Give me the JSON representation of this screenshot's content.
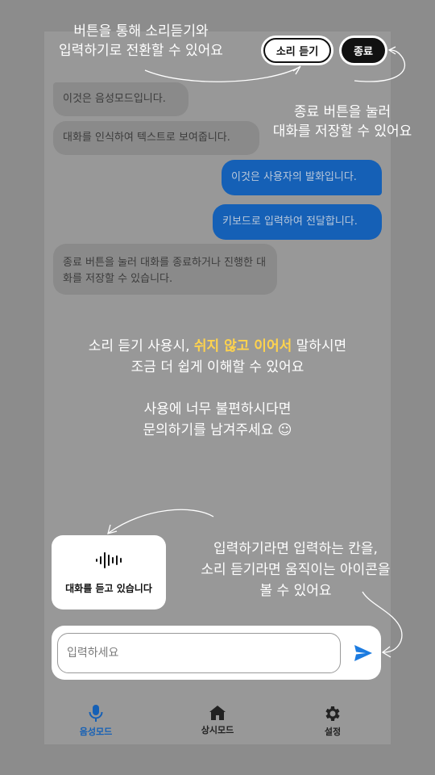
{
  "top_buttons": {
    "listen_label": "소리 듣기",
    "end_label": "종료"
  },
  "messages": [
    {
      "role": "bot",
      "text": "이것은 음성모드입니다."
    },
    {
      "role": "bot",
      "text": "대화를 인식하여 텍스트로 보여줍니다."
    },
    {
      "role": "user",
      "text": "이것은 사용자의 발화입니다."
    },
    {
      "role": "user",
      "text": "키보드로 입력하여 전달합니다."
    },
    {
      "role": "bot",
      "text": "종료 버튼을 눌러 대화를 종료하거나 진행한 대화를 저장할 수 있습니다."
    }
  ],
  "tutorial": {
    "top_line1": "버튼을 통해 소리듣기와",
    "top_line2": "입력하기로 전환할 수 있어요",
    "end_line1": "종료 버튼을 눌러",
    "end_line2": "대화를 저장할 수 있어요",
    "mid_line1_pre": "소리 듣기 사용시, ",
    "mid_line1_highlight": "쉬지 않고 이어서",
    "mid_line1_post": " 말하시면",
    "mid_line2": "조금 더 쉽게 이해할 수 있어요",
    "mid_line3": "사용에 너무 불편하시다면",
    "mid_line4": "문의하기를 남겨주세요 ☺",
    "bottom_line1": "입력하기라면 입력하는 칸을,",
    "bottom_line2": "소리 듣기라면 움직이는 아이콘을",
    "bottom_line3": "볼 수 있어요"
  },
  "listen_card": {
    "label": "대화를 듣고 있습니다"
  },
  "input": {
    "placeholder": "입력하세요",
    "value": ""
  },
  "nav": [
    {
      "label": "음성모드",
      "icon": "mic-icon",
      "active": true
    },
    {
      "label": "상시모드",
      "icon": "home-icon",
      "active": false
    },
    {
      "label": "설정",
      "icon": "gear-icon",
      "active": false
    }
  ],
  "colors": {
    "accent": "#1560b6",
    "highlight": "#ffd34d",
    "overlay": "#8c8c8c"
  }
}
